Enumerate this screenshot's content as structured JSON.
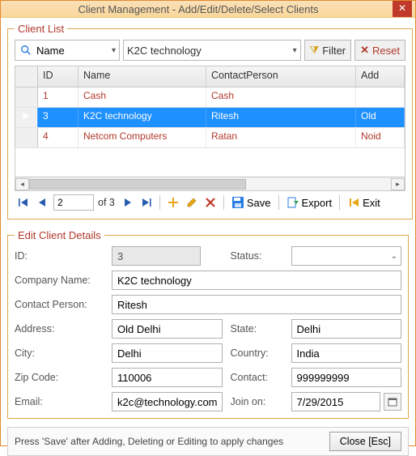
{
  "window": {
    "title": "Client Management - Add/Edit/Delete/Select Clients"
  },
  "client_list": {
    "legend": "Client List",
    "field_combo": "Name",
    "search_value": "K2C technology",
    "filter_btn": "Filter",
    "reset_btn": "Reset",
    "columns": [
      "ID",
      "Name",
      "ContactPerson",
      "Add"
    ],
    "rows": [
      {
        "id": "1",
        "name": "Cash",
        "contact": "Cash",
        "addr": ""
      },
      {
        "id": "3",
        "name": "K2C technology",
        "contact": "Ritesh",
        "addr": "Old "
      },
      {
        "id": "4",
        "name": "Netcom Computers",
        "contact": "Ratan",
        "addr": "Noid"
      }
    ],
    "selected_row": 1
  },
  "paging": {
    "current": "2",
    "of_label": "of 3",
    "save": "Save",
    "export": "Export",
    "exit": "Exit"
  },
  "edit": {
    "legend": "Edit Client Details",
    "labels": {
      "id": "ID:",
      "status": "Status:",
      "company": "Company Name:",
      "contact_person": "Contact Person:",
      "address": "Address:",
      "state": "State:",
      "city": "City:",
      "country": "Country:",
      "zip": "Zip Code:",
      "contact": "Contact:",
      "email": "Email:",
      "join": "Join on:"
    },
    "values": {
      "id": "3",
      "status": "",
      "company": "K2C technology",
      "contact_person": "Ritesh",
      "address": "Old Delhi",
      "state": "Delhi",
      "city": "Delhi",
      "country": "India",
      "zip": "110006",
      "contact": "999999999",
      "email": "k2c@technology.com",
      "join": "7/29/2015"
    }
  },
  "footer": {
    "hint": "Press 'Save' after Adding, Deleting or Editing to apply changes",
    "close": "Close [Esc]"
  }
}
